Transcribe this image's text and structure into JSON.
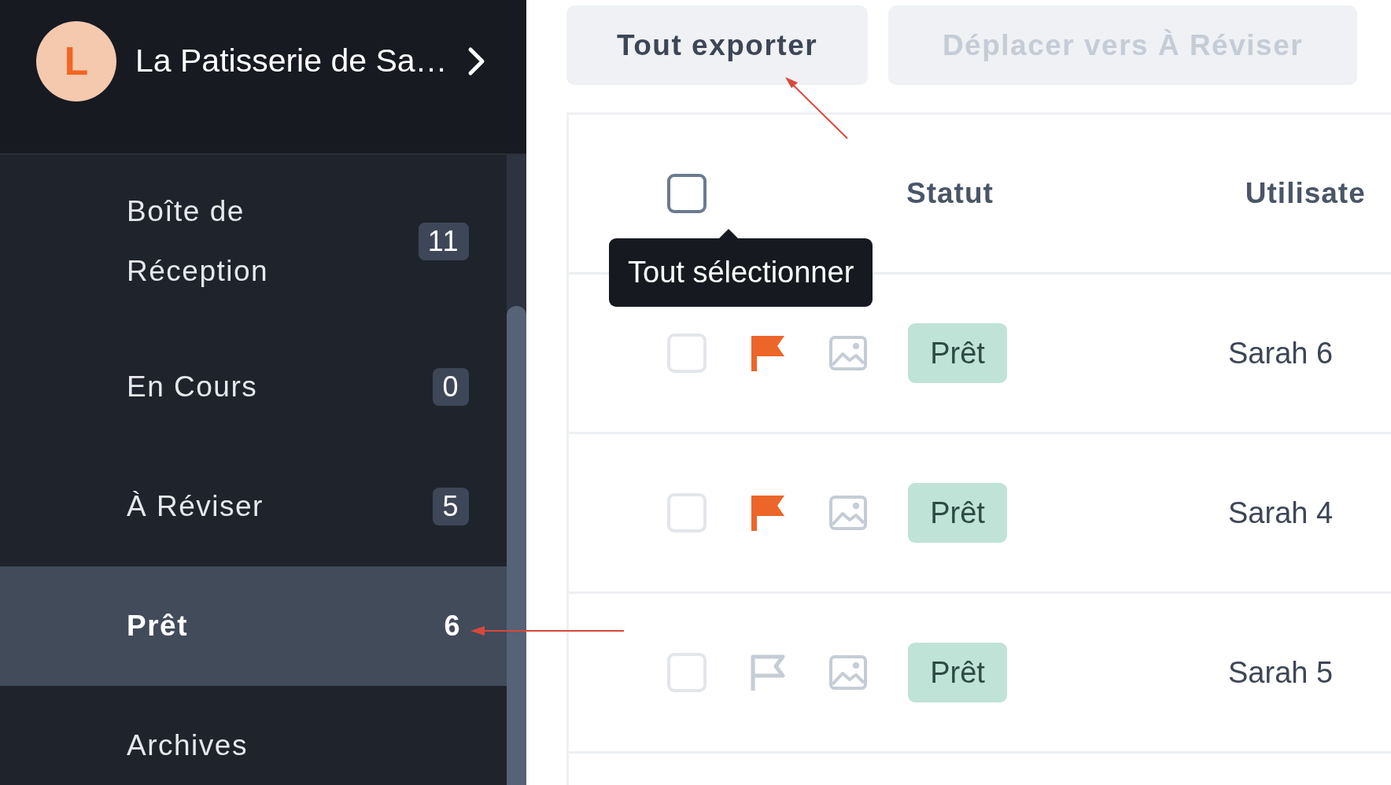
{
  "workspace": {
    "avatar_letter": "L",
    "name": "La Patisserie de Sa…"
  },
  "sidebar": {
    "items": [
      {
        "label": "Boîte de Réception",
        "count": "11",
        "selected": false
      },
      {
        "label": "En Cours",
        "count": "0",
        "selected": false
      },
      {
        "label": "À Réviser",
        "count": "5",
        "selected": false
      },
      {
        "label": "Prêt",
        "count": "6",
        "selected": true
      },
      {
        "label": "Archives",
        "selected": false
      }
    ]
  },
  "toolbar": {
    "buttons": [
      {
        "label": "Tout exporter",
        "disabled": false
      },
      {
        "label": "Déplacer vers À Réviser",
        "disabled": true
      }
    ]
  },
  "table": {
    "select_all": {
      "checked": false,
      "tooltip": "Tout sélectionner"
    },
    "columns": [
      "Statut",
      "Utilisate"
    ],
    "rows": [
      {
        "checked": false,
        "flagged": true,
        "status": "Prêt",
        "user": "Sarah 6"
      },
      {
        "checked": false,
        "flagged": true,
        "status": "Prêt",
        "user": "Sarah 4"
      },
      {
        "checked": false,
        "flagged": false,
        "status": "Prêt",
        "user": "Sarah 5"
      }
    ]
  }
}
